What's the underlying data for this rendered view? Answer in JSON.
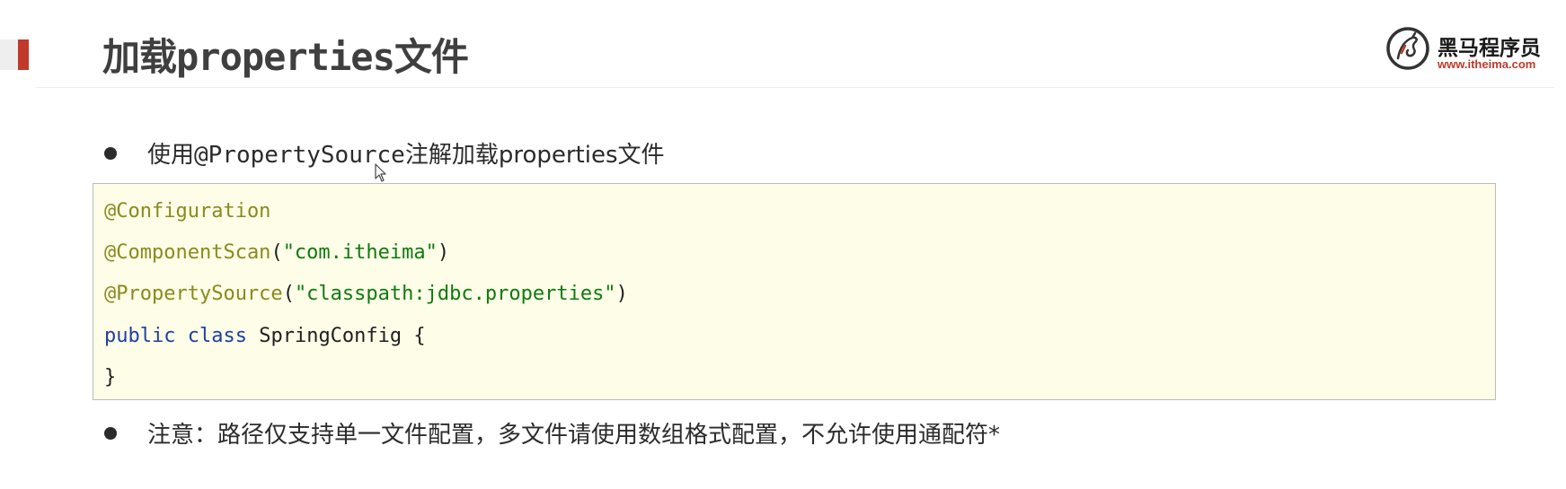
{
  "slide": {
    "title": "加载properties文件",
    "accent_color": "#c0392b"
  },
  "logo": {
    "icon": "horse-logo-icon",
    "name": "黑马程序员",
    "url": "www.itheima.com",
    "url_color": "#c0392b"
  },
  "bullets": [
    {
      "prefix": "使用",
      "code": "@PropertySource",
      "suffix": "注解加载properties文件"
    },
    {
      "text": "注意：路径仅支持单一文件配置，多文件请使用数组格式配置，不允许使用通配符*"
    }
  ],
  "code_block": {
    "line1": {
      "annotation": "@Configuration"
    },
    "line2": {
      "annotation": "@ComponentScan",
      "open": "(",
      "string": "\"com.itheima\"",
      "close": ")"
    },
    "line3": {
      "annotation": "@PropertySource",
      "open": "(",
      "string": "\"classpath:jdbc.properties\"",
      "close": ")"
    },
    "line4": {
      "keyword1": "public",
      "keyword2": "class",
      "rest": " SpringConfig {"
    },
    "line5": {
      "text": "}"
    },
    "colors": {
      "annotation": "#8a8a1c",
      "string": "#0f7a0f",
      "keyword": "#1f3fa0",
      "background": "#fdfde8"
    }
  },
  "pointer": {
    "icon": "mouse-pointer-icon"
  }
}
